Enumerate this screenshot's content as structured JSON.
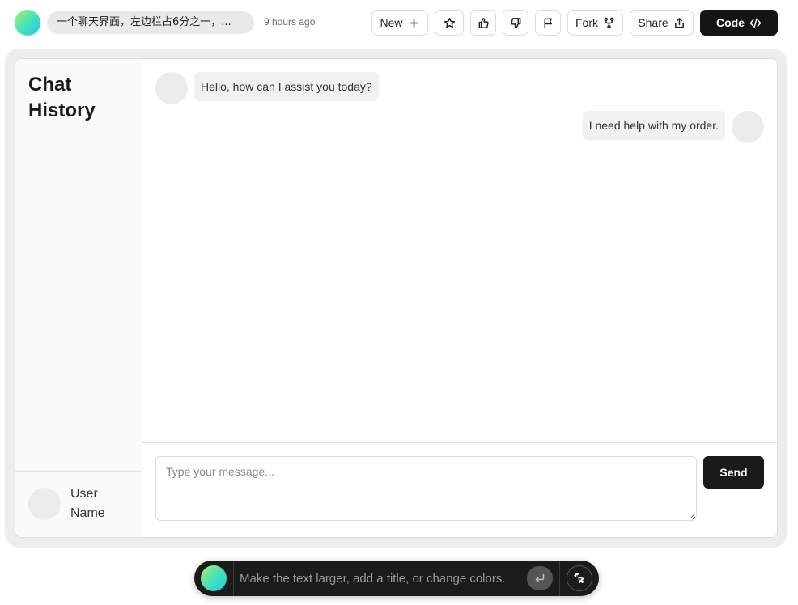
{
  "header": {
    "prompt_text": "一个聊天界面，左边栏占6分之一，...",
    "timestamp": "9 hours ago",
    "new_label": "New",
    "fork_label": "Fork",
    "share_label": "Share",
    "code_label": "Code"
  },
  "preview": {
    "sidebar": {
      "title": "Chat History",
      "user_name": "User Name"
    },
    "messages": [
      {
        "role": "assistant",
        "text": "Hello, how can I assist you today?"
      },
      {
        "role": "user",
        "text": "I need help with my order."
      }
    ],
    "composer": {
      "placeholder": "Type your message...",
      "send_label": "Send"
    }
  },
  "prompt_bar": {
    "placeholder": "Make the text larger, add a title, or change colors."
  },
  "icons": [
    "plus-icon",
    "star-icon",
    "thumbs-up-icon",
    "thumbs-down-icon",
    "flag-icon",
    "fork-icon",
    "share-icon",
    "code-icon",
    "enter-icon",
    "select-element-icon"
  ],
  "colors": {
    "dark_button": "#151515",
    "frame_bg": "#ededed",
    "bubble_bg": "#f1f1f1",
    "prompt_bar_bg": "#1b1b1b"
  }
}
